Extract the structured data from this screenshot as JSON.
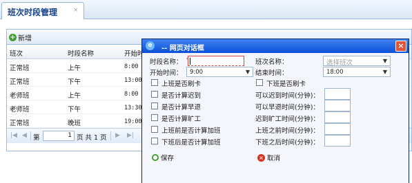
{
  "tab": {
    "title": "班次时段管理",
    "close": "×"
  },
  "toolbar": {
    "add_label": "新增"
  },
  "grid": {
    "headers": [
      "班次",
      "时段名称",
      "开始时"
    ],
    "rows": [
      [
        "正常班",
        "上午",
        "8:00"
      ],
      [
        "正常班",
        "下午",
        "13:00"
      ],
      [
        "老师班",
        "上午",
        "8:00"
      ],
      [
        "老师班",
        "下午",
        "13:30"
      ],
      [
        "正常班",
        "晚班",
        "19:00"
      ]
    ]
  },
  "pager": {
    "page_label": "第",
    "page_value": "1",
    "of_text": "页 共 1 页"
  },
  "dialog": {
    "title": "-- 网页对话框",
    "close": "×",
    "segment_name_label": "时段名称：",
    "required_mark": "*",
    "shift_name_label": "班次名称：",
    "shift_name_placeholder": "选择班次",
    "start_time_label": "开始时间：",
    "start_time_value": "9:00",
    "end_time_label": "结束时间：",
    "end_time_value": "18:00",
    "left_checks": [
      "上班是否刷卡",
      "是否计算迟到",
      "是否计算早退",
      "是否计算旷工",
      "上班前是否计算加班",
      "下班后是否计算加班"
    ],
    "right_top_check": "下班是否刷卡",
    "right_fields": [
      "可以迟到时间(分钟)：",
      "可以早退时间(分钟)：",
      "迟到旷工时间(分钟)：",
      "上班之前时间(分钟)：",
      "下班之后时间(分钟)："
    ],
    "save_label": "保存",
    "cancel_label": "取消"
  },
  "icons": {
    "add": "plus-circle-icon",
    "save": "save-icon",
    "cancel": "cancel-icon",
    "refresh": "refresh-icon",
    "close": "close-icon"
  },
  "colors": {
    "title_blue": "#15428b",
    "dialog_title_bar": "#0a50d8",
    "close_red": "#e0553a",
    "green": "#3f9e2c",
    "cancel_red": "#d9301f"
  }
}
